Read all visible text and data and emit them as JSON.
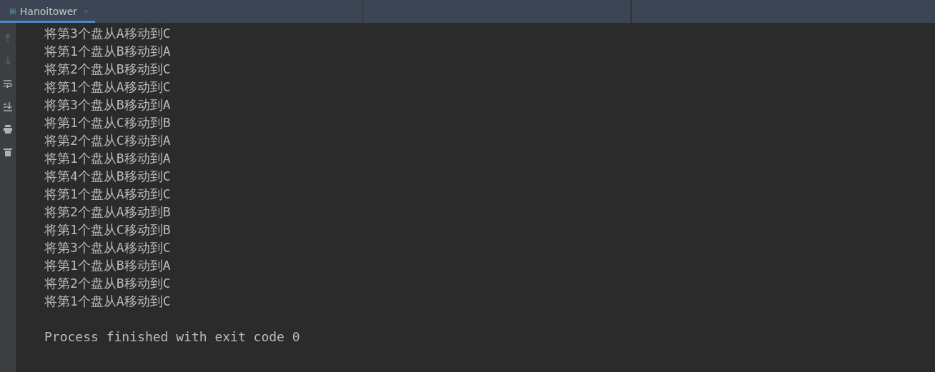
{
  "tabs": [
    {
      "label": "Hanoitower",
      "selected": true
    }
  ],
  "toolbar": [
    {
      "kind": "up",
      "disabled": true
    },
    {
      "kind": "down",
      "disabled": true
    },
    {
      "kind": "wrap",
      "disabled": false
    },
    {
      "kind": "scroll-end",
      "disabled": false
    },
    {
      "kind": "print",
      "disabled": false
    },
    {
      "kind": "delete",
      "disabled": false
    }
  ],
  "output_lines": [
    "将第3个盘从A移动到C",
    "将第1个盘从B移动到A",
    "将第2个盘从B移动到C",
    "将第1个盘从A移动到C",
    "将第3个盘从B移动到A",
    "将第1个盘从C移动到B",
    "将第2个盘从C移动到A",
    "将第1个盘从B移动到A",
    "将第4个盘从B移动到C",
    "将第1个盘从A移动到C",
    "将第2个盘从A移动到B",
    "将第1个盘从C移动到B",
    "将第3个盘从A移动到C",
    "将第1个盘从B移动到A",
    "将第2个盘从B移动到C",
    "将第1个盘从A移动到C"
  ],
  "exit_message": "Process finished with exit code 0"
}
